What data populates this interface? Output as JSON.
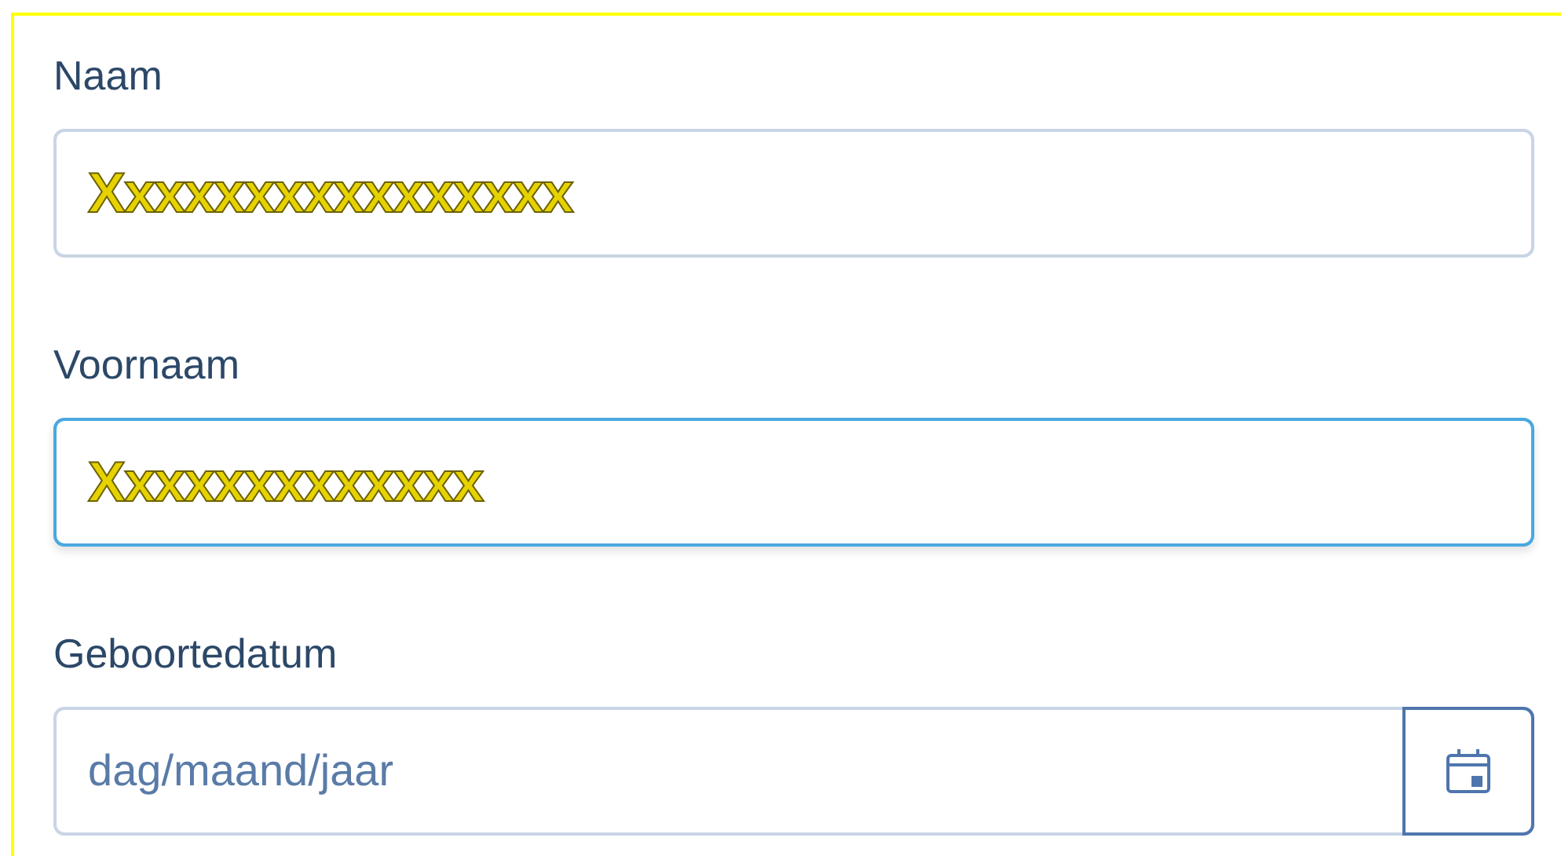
{
  "form": {
    "fields": [
      {
        "kind": "text",
        "label": "Naam",
        "value": "Xxxxxxxxxxxxxxxx",
        "focused": false
      },
      {
        "kind": "text",
        "label": "Voornaam",
        "value": "Xxxxxxxxxxxxx",
        "focused": true
      },
      {
        "kind": "date",
        "label": "Geboortedatum",
        "placeholder": "dag/maand/jaar",
        "focused": false
      }
    ]
  }
}
